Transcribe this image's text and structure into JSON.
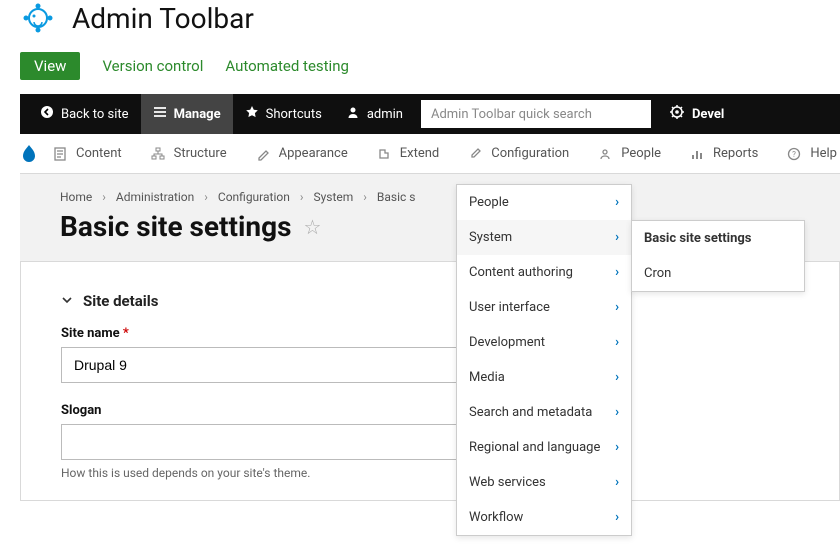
{
  "header": {
    "title": "Admin Toolbar"
  },
  "project_tabs": {
    "view": "View",
    "version_control": "Version control",
    "automated_testing": "Automated testing"
  },
  "admin_bar": {
    "back": "Back to site",
    "manage": "Manage",
    "shortcuts": "Shortcuts",
    "user": "admin",
    "search_placeholder": "Admin Toolbar quick search",
    "devel": "Devel"
  },
  "secondary_nav": {
    "items": [
      {
        "label": "Content"
      },
      {
        "label": "Structure"
      },
      {
        "label": "Appearance"
      },
      {
        "label": "Extend"
      },
      {
        "label": "Configuration"
      },
      {
        "label": "People"
      },
      {
        "label": "Reports"
      },
      {
        "label": "Help"
      }
    ]
  },
  "breadcrumbs": [
    "Home",
    "Administration",
    "Configuration",
    "System",
    "Basic site settings"
  ],
  "page_title": "Basic site settings",
  "form": {
    "details_label": "Site details",
    "site_name_label": "Site name",
    "site_name_value": "Drupal 9",
    "slogan_label": "Slogan",
    "slogan_value": "",
    "slogan_help": "How this is used depends on your site's theme."
  },
  "config_menu": {
    "items": [
      "People",
      "System",
      "Content authoring",
      "User interface",
      "Development",
      "Media",
      "Search and metadata",
      "Regional and language",
      "Web services",
      "Workflow"
    ],
    "hover_index": 1
  },
  "config_system_submenu": {
    "items": [
      {
        "label": "Basic site settings",
        "bold": true
      },
      {
        "label": "Cron",
        "bold": false
      }
    ]
  }
}
